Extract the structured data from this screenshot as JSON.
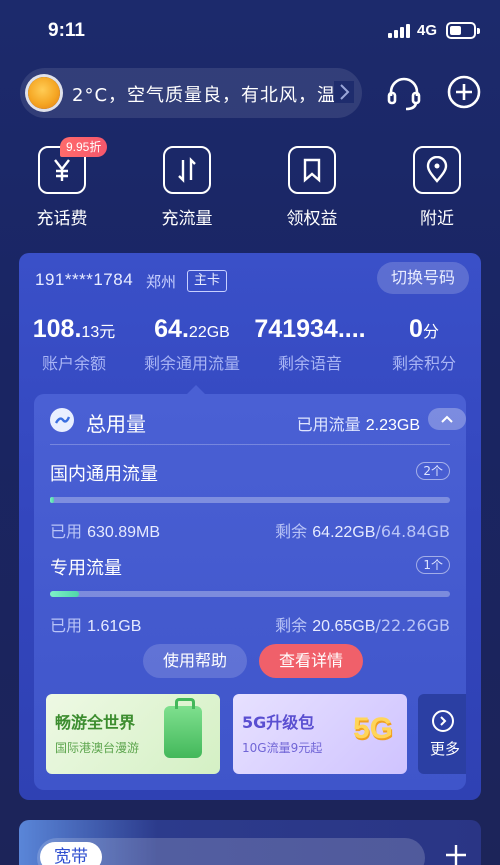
{
  "status_bar": {
    "time": "9:11",
    "network": "4G"
  },
  "header": {
    "weather_text": "2°C，空气质量良，有北风，温",
    "icons": [
      "sun-icon",
      "chevron-right-icon",
      "headset-icon",
      "plus-icon"
    ]
  },
  "quick_actions": [
    {
      "label": "充话费",
      "icon": "yuan-icon",
      "badge": "9.95折"
    },
    {
      "label": "充流量",
      "icon": "data-arrows-icon"
    },
    {
      "label": "领权益",
      "icon": "bookmark-icon"
    },
    {
      "label": "附近",
      "icon": "location-pin-icon"
    }
  ],
  "account": {
    "phone": "191****1784",
    "city": "郑州",
    "tag": "主卡",
    "switch_label": "切换号码"
  },
  "stats": [
    {
      "value_main": "108.",
      "value_small": "13元",
      "label": "账户余额"
    },
    {
      "value_main": "64.",
      "value_small": "22GB",
      "label": "剩余通用流量"
    },
    {
      "value_main": "741934....",
      "value_small": "",
      "label": "剩余语音"
    },
    {
      "value_main": "0",
      "value_small": "分",
      "label": "剩余积分"
    }
  ],
  "usage": {
    "title": "总用量",
    "used_label": "已用流量",
    "used_value": "2.23GB",
    "sections": [
      {
        "title": "国内通用流量",
        "count": "2个",
        "progress": 0.0097,
        "used_label": "已用",
        "used_value": "630.89MB",
        "remain_label": "剩余",
        "remain_value": "64.22GB",
        "total_value": "/64.84GB"
      },
      {
        "title": "专用流量",
        "count": "1个",
        "progress": 0.072,
        "used_label": "已用",
        "used_value": "1.61GB",
        "remain_label": "剩余",
        "remain_value": "20.65GB",
        "total_value": "/22.26GB"
      }
    ],
    "help_label": "使用帮助",
    "detail_label": "查看详情"
  },
  "promos": [
    {
      "title": "畅游全世界",
      "subtitle": "国际港澳台漫游"
    },
    {
      "title": "5G升级包",
      "subtitle": "10G流量9元起",
      "art_text": "5G"
    },
    {
      "title": "更多"
    }
  ],
  "bottom": {
    "tab_label": "宽带"
  },
  "colors": {
    "background": "#1c2a6c",
    "card": "#3a50c8",
    "accent_red": "#f0606a",
    "progress_green": "#5fe0b0"
  }
}
